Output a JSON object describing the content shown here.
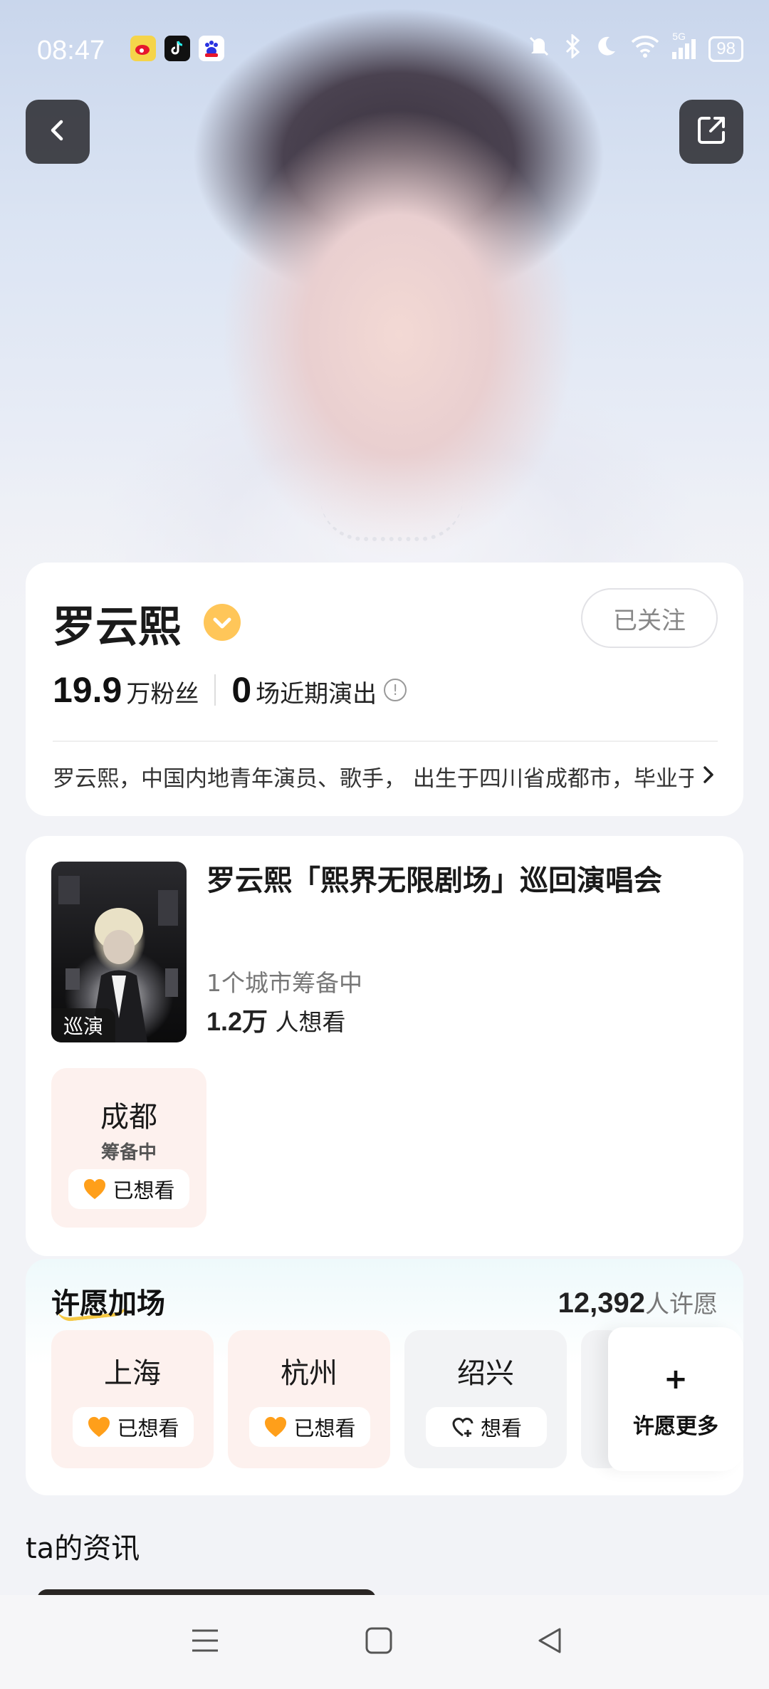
{
  "status_bar": {
    "time": "08:47",
    "battery": "98",
    "network": "5G"
  },
  "artist": {
    "name": "罗云熙",
    "follow_label": "已关注",
    "fans_num": "19.9",
    "fans_label": "万粉丝",
    "shows_num": "0",
    "shows_label": "场近期演出",
    "bio": "罗云熙，中国内地青年演员、歌手， 出生于四川省成都市，毕业于上海戏剧学院"
  },
  "tour": {
    "title": "罗云熙「熙界无限剧场」巡回演唱会",
    "tag": "巡演",
    "cities_status": "1个城市筹备中",
    "want_num": "1.2万",
    "want_label": " 人想看",
    "city": {
      "name": "成都",
      "status": "筹备中",
      "want_label": "已想看"
    }
  },
  "wish": {
    "title": "许愿加场",
    "count_num": "12,392",
    "count_label": "人许愿",
    "cities": [
      {
        "name": "上海",
        "label": "已想看",
        "wanted": true
      },
      {
        "name": "杭州",
        "label": "已想看",
        "wanted": true
      },
      {
        "name": "绍兴",
        "label": "想看",
        "wanted": false
      }
    ],
    "more_plus": "+",
    "more_label": "许愿更多"
  },
  "news": {
    "title": "ta的资讯"
  },
  "colors": {
    "accent_orange": "#ff9f1a",
    "verified_yellow": "#ffc659",
    "tile_pink": "#fdf1ee"
  },
  "icons": [
    "back-icon",
    "share-icon",
    "verified-icon",
    "info-icon",
    "chevron-right-icon",
    "heart-icon",
    "heart-plus-icon",
    "menu-icon",
    "home-icon",
    "back-triangle-icon"
  ]
}
